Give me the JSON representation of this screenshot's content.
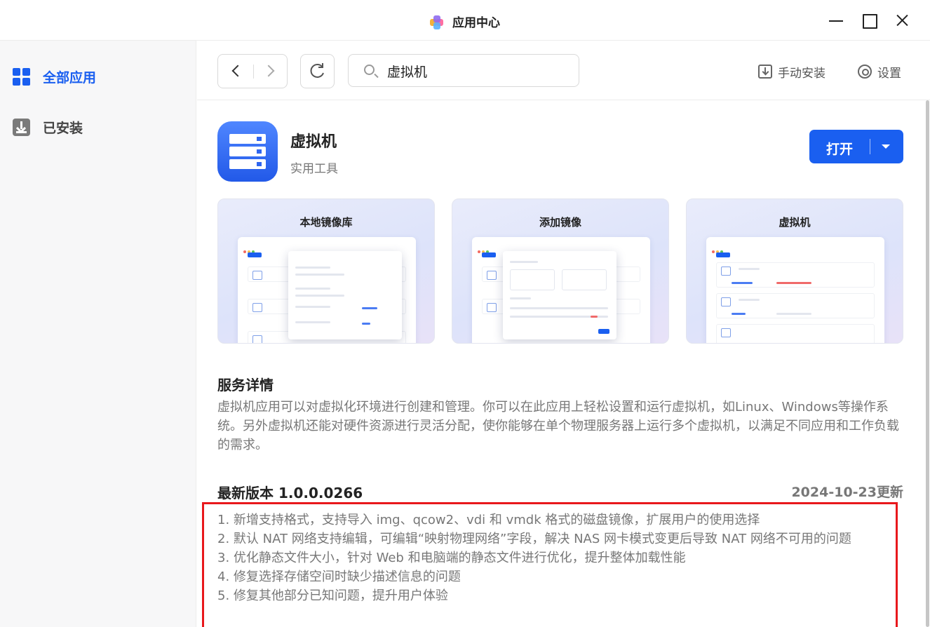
{
  "window": {
    "title": "应用中心"
  },
  "sidebar": {
    "items": [
      {
        "label": "全部应用",
        "icon": "grid-icon",
        "active": true
      },
      {
        "label": "已安装",
        "icon": "download-icon",
        "active": false
      }
    ]
  },
  "toolbar": {
    "search_value": "虚拟机",
    "manual_install_label": "手动安装",
    "settings_label": "设置"
  },
  "app": {
    "name": "虚拟机",
    "category": "实用工具",
    "open_label": "打开"
  },
  "screenshots": [
    {
      "title": "本地镜像库"
    },
    {
      "title": "添加镜像"
    },
    {
      "title": "虚拟机"
    }
  ],
  "details": {
    "title": "服务详情",
    "description": "虚拟机应用可以对虚拟化环境进行创建和管理。你可以在此应用上轻松设置和运行虚拟机，如Linux、Windows等操作系统。另外虚拟机还能对硬件资源进行灵活分配，使你能够在单个物理服务器上运行多个虚拟机，以满足不同应用和工作负载的需求。"
  },
  "version": {
    "title": "最新版本 1.0.0.0266",
    "updated": "2024-10-23更新",
    "notes": [
      "1. 新增支持格式，支持导入 img、qcow2、vdi 和 vmdk 格式的磁盘镜像，扩展用户的使用选择",
      "2. 默认 NAT 网络支持编辑，可编辑“映射物理网络”字段，解决 NAS 网卡模式变更后导致 NAT 网络不可用的问题",
      "3. 优化静态文件大小，针对 Web 和电脑端的静态文件进行优化，提升整体加载性能",
      "4. 修复选择存储空间时缺少描述信息的问题",
      "5. 修复其他部分已知问题，提升用户体验"
    ]
  },
  "colors": {
    "accent": "#1a5ff0",
    "highlight": "#e8181c"
  }
}
